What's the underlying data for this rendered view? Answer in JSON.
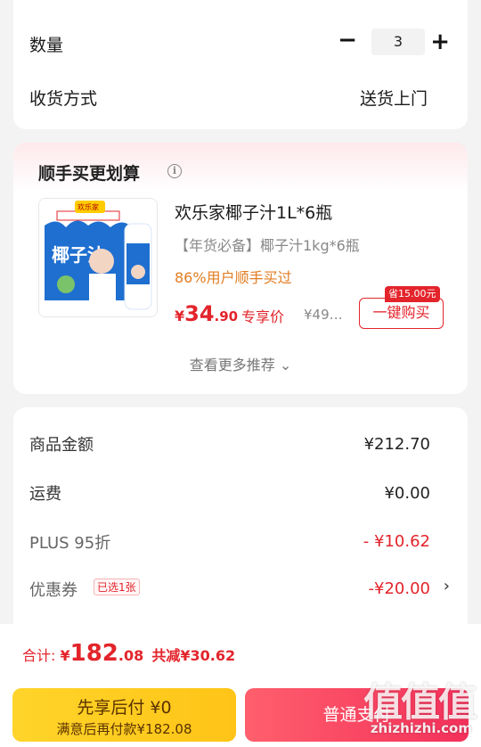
{
  "order": {
    "quantity_label": "数量",
    "quantity_value": "3",
    "minus_symbol": "−",
    "plus_symbol": "+",
    "delivery_label": "收货方式",
    "delivery_value": "送货上门"
  },
  "recommend": {
    "title": "顺手买更划算",
    "info_symbol": "i",
    "product_name": "欢乐家椰子汁1L*6瓶",
    "product_spec": "【年货必备】椰子汁1kg*6瓶",
    "social_proof": "86%用户顺手买过",
    "price_symbol": "¥",
    "price_int": "34",
    "price_dec": ".90",
    "price_tag": "专享价",
    "original_price": "¥49…",
    "save_badge": "省15.00元",
    "buy_button": "一键购买",
    "more_link": "查看更多推荐 ⌄",
    "image_text": "椰子汁",
    "image_brand": "欢乐家"
  },
  "summary": {
    "goods_label": "商品金额",
    "goods_value": "¥212.70",
    "shipping_label": "运费",
    "shipping_value": "¥0.00",
    "plus_label": "PLUS 95折",
    "plus_value": "- ¥10.62",
    "coupon_label": "优惠券",
    "coupon_badge": "已选1张",
    "coupon_value": "-¥20.00",
    "coupon_chevron": "›"
  },
  "footer": {
    "total_label": "合计: ",
    "total_symbol": "¥",
    "total_int": "182",
    "total_dec": ".08",
    "total_saved": "共减¥30.62",
    "later_line1": "先享后付 ¥0",
    "later_line2": "满意后再付款¥182.08",
    "pay_button": "普通支付"
  },
  "watermark": {
    "logo": "值值值",
    "url": "zhizhizhi.com"
  },
  "colors": {
    "accent_red": "#e3242b",
    "orange": "#e27d22",
    "yellow_button": "#ffc417",
    "pink_button": "#f3305a"
  }
}
